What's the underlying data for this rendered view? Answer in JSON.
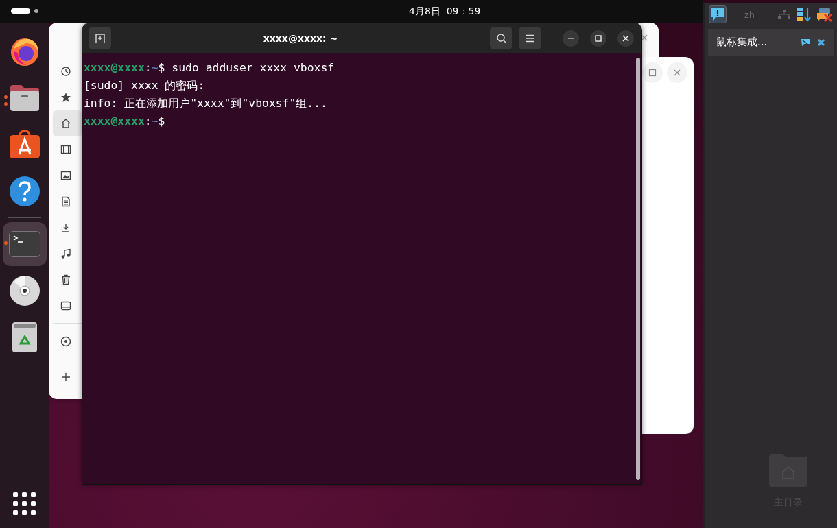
{
  "top_bar": {
    "clock": "4月8日  09：59"
  },
  "dock": {
    "items": [
      {
        "kind": "firefox",
        "running": false,
        "selected": false
      },
      {
        "kind": "files",
        "running": true,
        "selected": false
      },
      {
        "kind": "store",
        "running": false,
        "selected": false
      },
      {
        "kind": "help",
        "running": false,
        "selected": false
      },
      {
        "kind": "terminal",
        "running": true,
        "selected": true
      },
      {
        "kind": "disc",
        "running": false,
        "selected": false
      },
      {
        "kind": "trash",
        "running": false,
        "selected": false
      }
    ]
  },
  "files_window": {
    "sidebar": [
      {
        "kind": "recent",
        "selected": false
      },
      {
        "kind": "star",
        "selected": false
      },
      {
        "kind": "home",
        "selected": true
      },
      {
        "kind": "film",
        "selected": false
      },
      {
        "kind": "image",
        "selected": false
      },
      {
        "kind": "doc",
        "selected": false
      },
      {
        "kind": "download",
        "selected": false
      },
      {
        "kind": "music",
        "selected": false
      },
      {
        "kind": "trash",
        "selected": false
      },
      {
        "kind": "drive",
        "selected": false
      },
      {
        "kind": "disc",
        "selected": false
      },
      {
        "kind": "add",
        "selected": false
      }
    ]
  },
  "terminal": {
    "title": "xxxx@xxxx: ~",
    "lines": [
      {
        "kind": "prompt",
        "user": "xxxx@xxxx",
        "sep": ":",
        "path": "~",
        "sign": "$",
        "command": "sudo adduser xxxx vboxsf"
      },
      {
        "kind": "output",
        "text": "[sudo] xxxx 的密码:"
      },
      {
        "kind": "output",
        "text": "info: 正在添加用户\"xxxx\"到\"vboxsf\"组..."
      },
      {
        "kind": "prompt",
        "user": "xxxx@xxxx",
        "sep": ":",
        "path": "~",
        "sign": "$"
      }
    ]
  },
  "tray": {
    "language": "zh",
    "notification": "鼠标集成...",
    "home_folder": "主目录"
  }
}
